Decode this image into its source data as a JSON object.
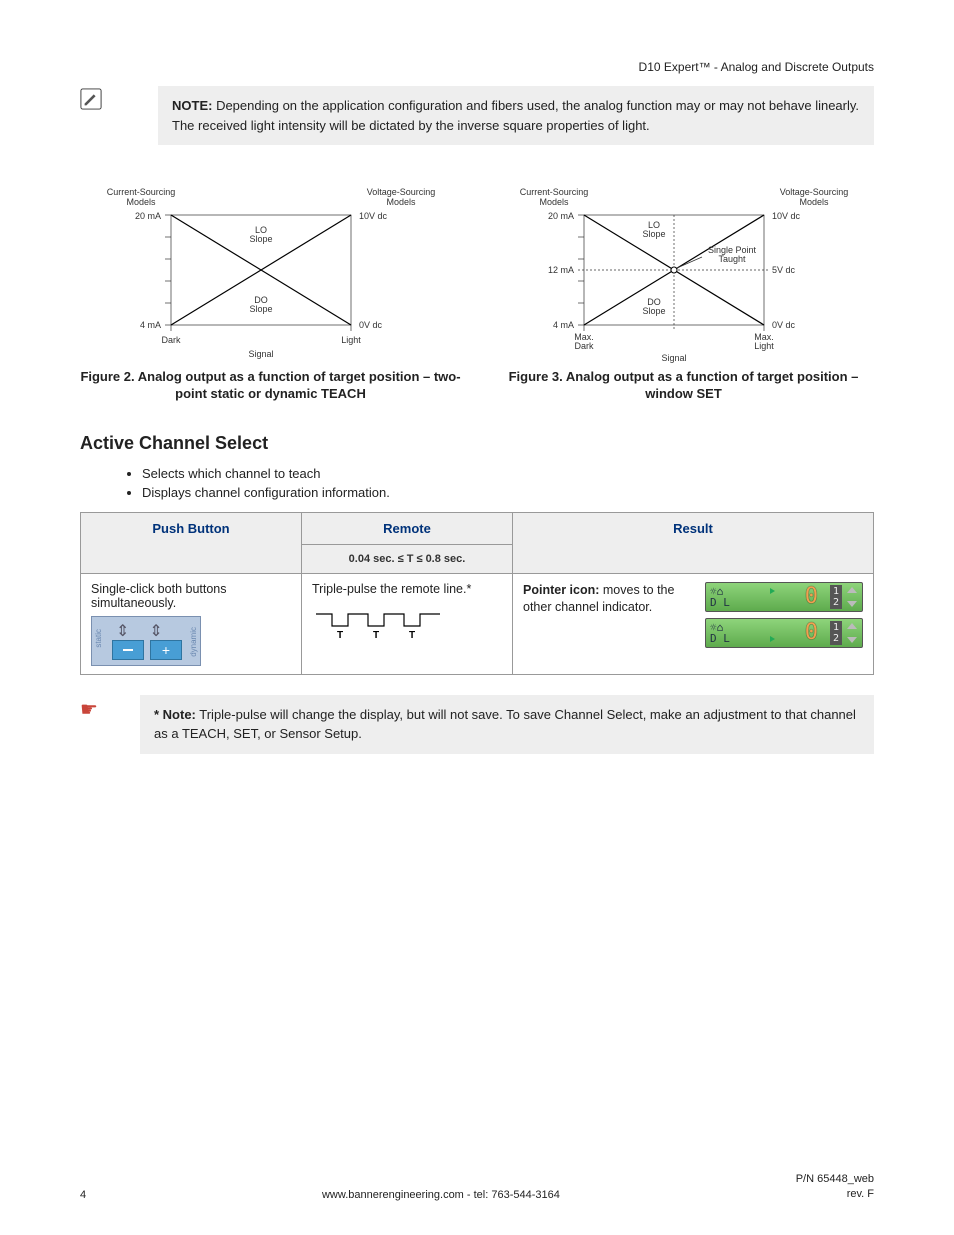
{
  "header": {
    "title": "D10 Expert™ - Analog and Discrete Outputs"
  },
  "note": {
    "label": "NOTE:",
    "text": " Depending on the application configuration and fibers used, the analog function may or may not behave linearly. The received light intensity will be dictated by the inverse square properties of light."
  },
  "chart_data": [
    {
      "type": "line",
      "title": "Figure 2 main",
      "left_axis_label": "Current-Sourcing Models",
      "right_axis_label": "Voltage-Sourcing Models",
      "x_ticks": [
        "Dark",
        "Light"
      ],
      "xlabel": "Signal",
      "left_ticks": [
        "4 mA",
        "20 mA"
      ],
      "right_ticks": [
        "0V dc",
        "10V dc"
      ],
      "series": [
        {
          "name": "LO Slope",
          "x": [
            0,
            1
          ],
          "y": [
            1,
            0
          ],
          "desc": "high-left to low-right"
        },
        {
          "name": "DO Slope",
          "x": [
            0,
            1
          ],
          "y": [
            0,
            1
          ],
          "desc": "low-left to high-right"
        }
      ]
    },
    {
      "type": "line",
      "title": "Figure 3 main",
      "left_axis_label": "Current-Sourcing Models",
      "right_axis_label": "Voltage-Sourcing Models",
      "x_ticks": [
        "Max. Dark",
        "Max. Light"
      ],
      "xlabel": "Signal",
      "left_ticks": [
        "4 mA",
        "12 mA",
        "20 mA"
      ],
      "right_ticks": [
        "0V dc",
        "5V dc",
        "10V dc"
      ],
      "annotation": "Single Point Taught",
      "series": [
        {
          "name": "LO Slope",
          "x": [
            0,
            0.5,
            1
          ],
          "y": [
            1,
            0.5,
            0
          ],
          "desc": "high-left to low-right through midpoint"
        },
        {
          "name": "DO Slope",
          "x": [
            0,
            0.5,
            1
          ],
          "y": [
            0,
            0.5,
            1
          ],
          "desc": "low-left to high-right through midpoint"
        }
      ]
    }
  ],
  "fig2": {
    "caption": "Figure 2. Analog output as a function of target position – two-point static or dynamic TEACH",
    "labels": {
      "cs": "Current-Sourcing",
      "models": "Models",
      "vs": "Voltage-Sourcing",
      "y20": "20 mA",
      "y4": "4 mA",
      "r10": "10V dc",
      "r0": "0V dc",
      "dark": "Dark",
      "light": "Light",
      "signal": "Signal",
      "lo1": "LO",
      "lo2": "Slope",
      "do1": "DO",
      "do2": "Slope"
    }
  },
  "fig3": {
    "caption": "Figure 3. Analog output as a function of target position – window SET",
    "labels": {
      "cs": "Current-Sourcing",
      "models": "Models",
      "vs": "Voltage-Sourcing",
      "y20": "20 mA",
      "y12": "12 mA",
      "y4": "4 mA",
      "r10": "10V dc",
      "r5": "5V dc",
      "r0": "0V dc",
      "xd1": "Max.",
      "xd2": "Dark",
      "xl1": "Max.",
      "xl2": "Light",
      "signal": "Signal",
      "lo1": "LO",
      "lo2": "Slope",
      "do1": "DO",
      "do2": "Slope",
      "sp1": "Single Point",
      "sp2": "Taught"
    }
  },
  "section": {
    "title": "Active Channel Select",
    "bullets": [
      "Selects which channel to teach",
      "Displays channel configuration information."
    ]
  },
  "table": {
    "headers": {
      "push": "Push Button",
      "remote": "Remote",
      "remote_sub": "0.04 sec. ≤ T ≤ 0.8 sec.",
      "result": "Result"
    },
    "row": {
      "push": "Single-click both buttons simultaneously.",
      "remote": "Triple-pulse the remote line.*",
      "pulse_t": "T",
      "result_bold": "Pointer icon:",
      "result_rest": " moves to the other channel indicator.",
      "lcd_left_top": "☼⌂",
      "lcd_left_bot": "D L",
      "lcd_digit": "0",
      "lcd_side1": "1",
      "lcd_side2": "2",
      "panel_static": "static",
      "panel_dynamic": "dynamic",
      "panel_plus": "+"
    }
  },
  "subnote": {
    "label": "* Note:",
    "text": " Triple-pulse will change the display, but will not save. To save Channel Select, make an adjustment to that channel as a TEACH, SET, or Sensor Setup."
  },
  "footer": {
    "page": "4",
    "center": "www.bannerengineering.com - tel: 763-544-3164",
    "right1": "P/N 65448_web",
    "right2": "rev. F"
  }
}
